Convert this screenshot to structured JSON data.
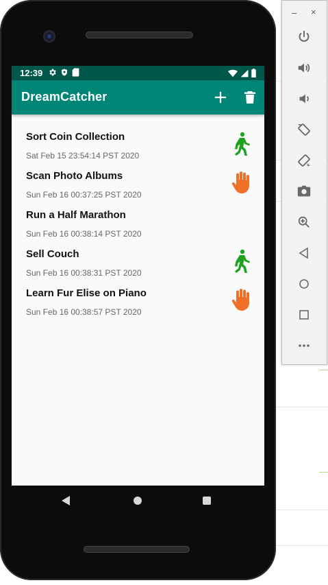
{
  "window_controls": {
    "minimize": "–",
    "close": "×"
  },
  "status_bar": {
    "time": "12:39"
  },
  "app_bar": {
    "title": "DreamCatcher"
  },
  "dreams": [
    {
      "title": "Sort Coin Collection",
      "date": "Sat Feb 15 23:54:14 PST 2020",
      "icon": "walk-icon"
    },
    {
      "title": "Scan Photo Albums",
      "date": "Sun Feb 16 00:37:25 PST 2020",
      "icon": "hand-stop-icon"
    },
    {
      "title": "Run a Half Marathon",
      "date": "Sun Feb 16 00:38:14 PST 2020",
      "icon": ""
    },
    {
      "title": "Sell Couch",
      "date": "Sun Feb 16 00:38:31 PST 2020",
      "icon": "walk-icon"
    },
    {
      "title": "Learn Fur Elise on Piano",
      "date": "Sun Feb 16 00:38:57 PST 2020",
      "icon": "hand-stop-icon"
    }
  ],
  "colors": {
    "primary": "#008577",
    "primary_dark": "#00574b",
    "walk_icon": "#1fa21f",
    "stop_icon": "#f07028"
  },
  "emulator_tools": [
    "power-icon",
    "volume-up-icon",
    "volume-down-icon",
    "rotate-left-icon",
    "rotate-right-icon",
    "camera-icon",
    "zoom-icon",
    "back-icon",
    "home-icon",
    "overview-icon",
    "more-icon"
  ]
}
